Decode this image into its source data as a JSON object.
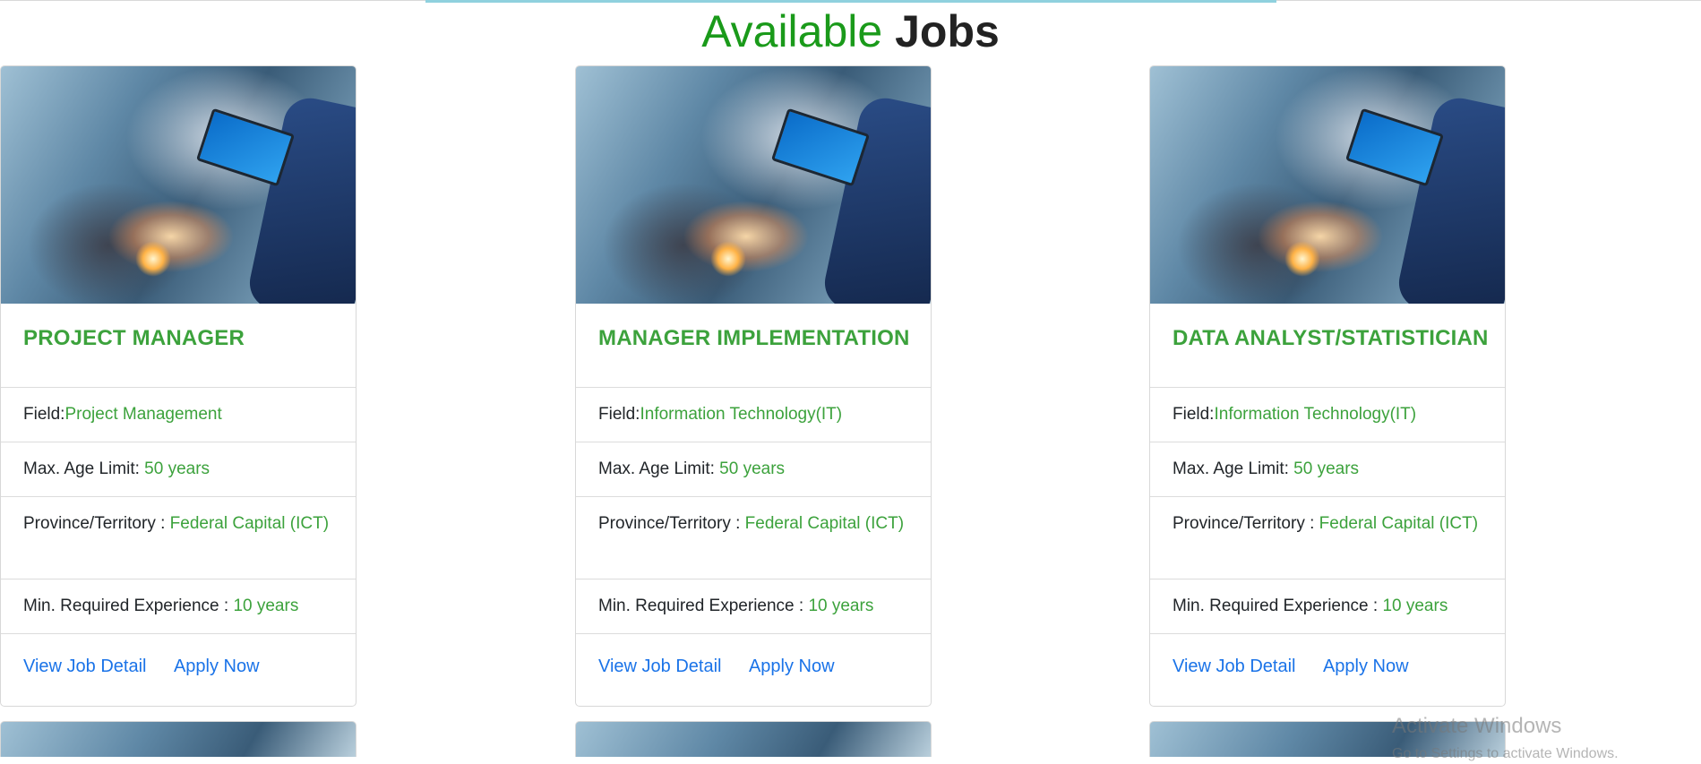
{
  "page": {
    "title_part1": "Available",
    "title_part2": "Jobs"
  },
  "jobs": [
    {
      "title": "PROJECT MANAGER",
      "field_label": "Field:",
      "field_value": "Project Management",
      "age_label": "Max. Age Limit:",
      "age_value": "50 years",
      "province_label": "Province/Territory :",
      "province_value": "Federal Capital (ICT)",
      "experience_label": "Min. Required Experience :",
      "experience_value": "10 years",
      "view_label": "View Job Detail",
      "apply_label": "Apply Now"
    },
    {
      "title": "MANAGER IMPLEMENTATION",
      "field_label": "Field:",
      "field_value": "Information Technology(IT)",
      "age_label": "Max. Age Limit:",
      "age_value": "50 years",
      "province_label": "Province/Territory :",
      "province_value": "Federal Capital (ICT)",
      "experience_label": "Min. Required Experience :",
      "experience_value": "10 years",
      "view_label": "View Job Detail",
      "apply_label": "Apply Now"
    },
    {
      "title": "DATA ANALYST/STATISTICIAN",
      "field_label": "Field:",
      "field_value": "Information Technology(IT)",
      "age_label": "Max. Age Limit:",
      "age_value": "50 years",
      "province_label": "Province/Territory :",
      "province_value": "Federal Capital (ICT)",
      "experience_label": "Min. Required Experience :",
      "experience_value": "10 years",
      "view_label": "View Job Detail",
      "apply_label": "Apply Now"
    }
  ],
  "watermark": {
    "title": "Activate Windows",
    "subtitle": "Go to Settings to activate Windows."
  },
  "colors": {
    "title_green": "#1a9a1a",
    "value_green": "#3ca23c",
    "link_blue": "#1a73e8",
    "accent_line": "#8fd1de"
  }
}
